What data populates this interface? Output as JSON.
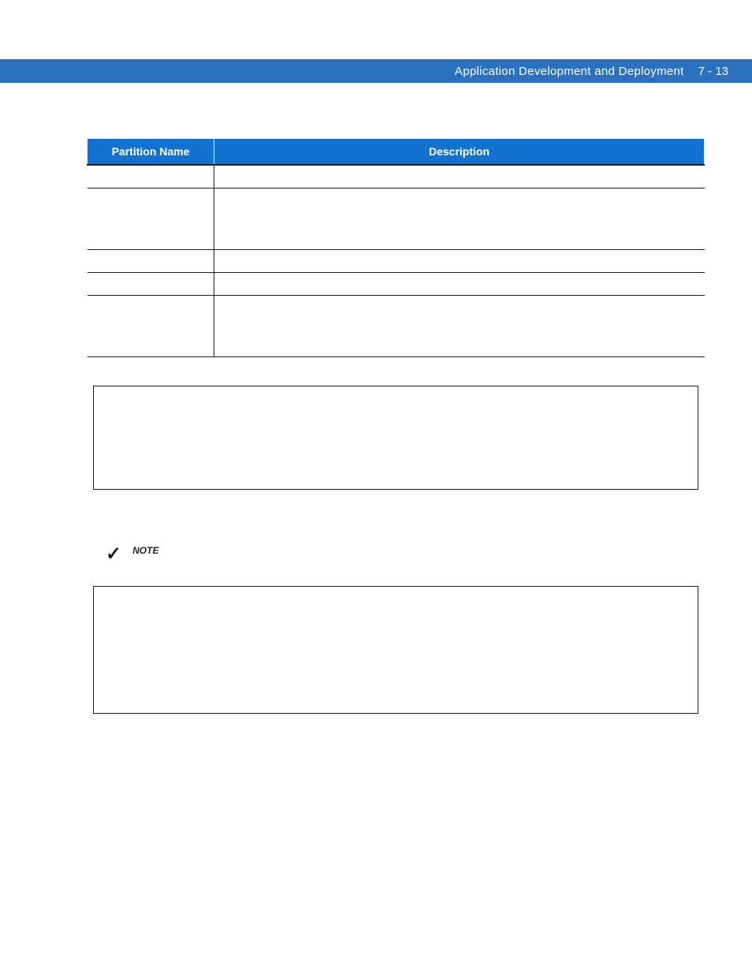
{
  "header": {
    "chapter": "Application Development and Deployment",
    "page": "7 - 13"
  },
  "table": {
    "headers": [
      "Partition Name",
      "Description"
    ],
    "rows": [
      {
        "name": "",
        "desc": ""
      },
      {
        "name": "",
        "desc": ""
      },
      {
        "name": "",
        "desc": ""
      },
      {
        "name": "",
        "desc": ""
      },
      {
        "name": "",
        "desc": ""
      }
    ]
  },
  "note": {
    "label": "NOTE"
  }
}
